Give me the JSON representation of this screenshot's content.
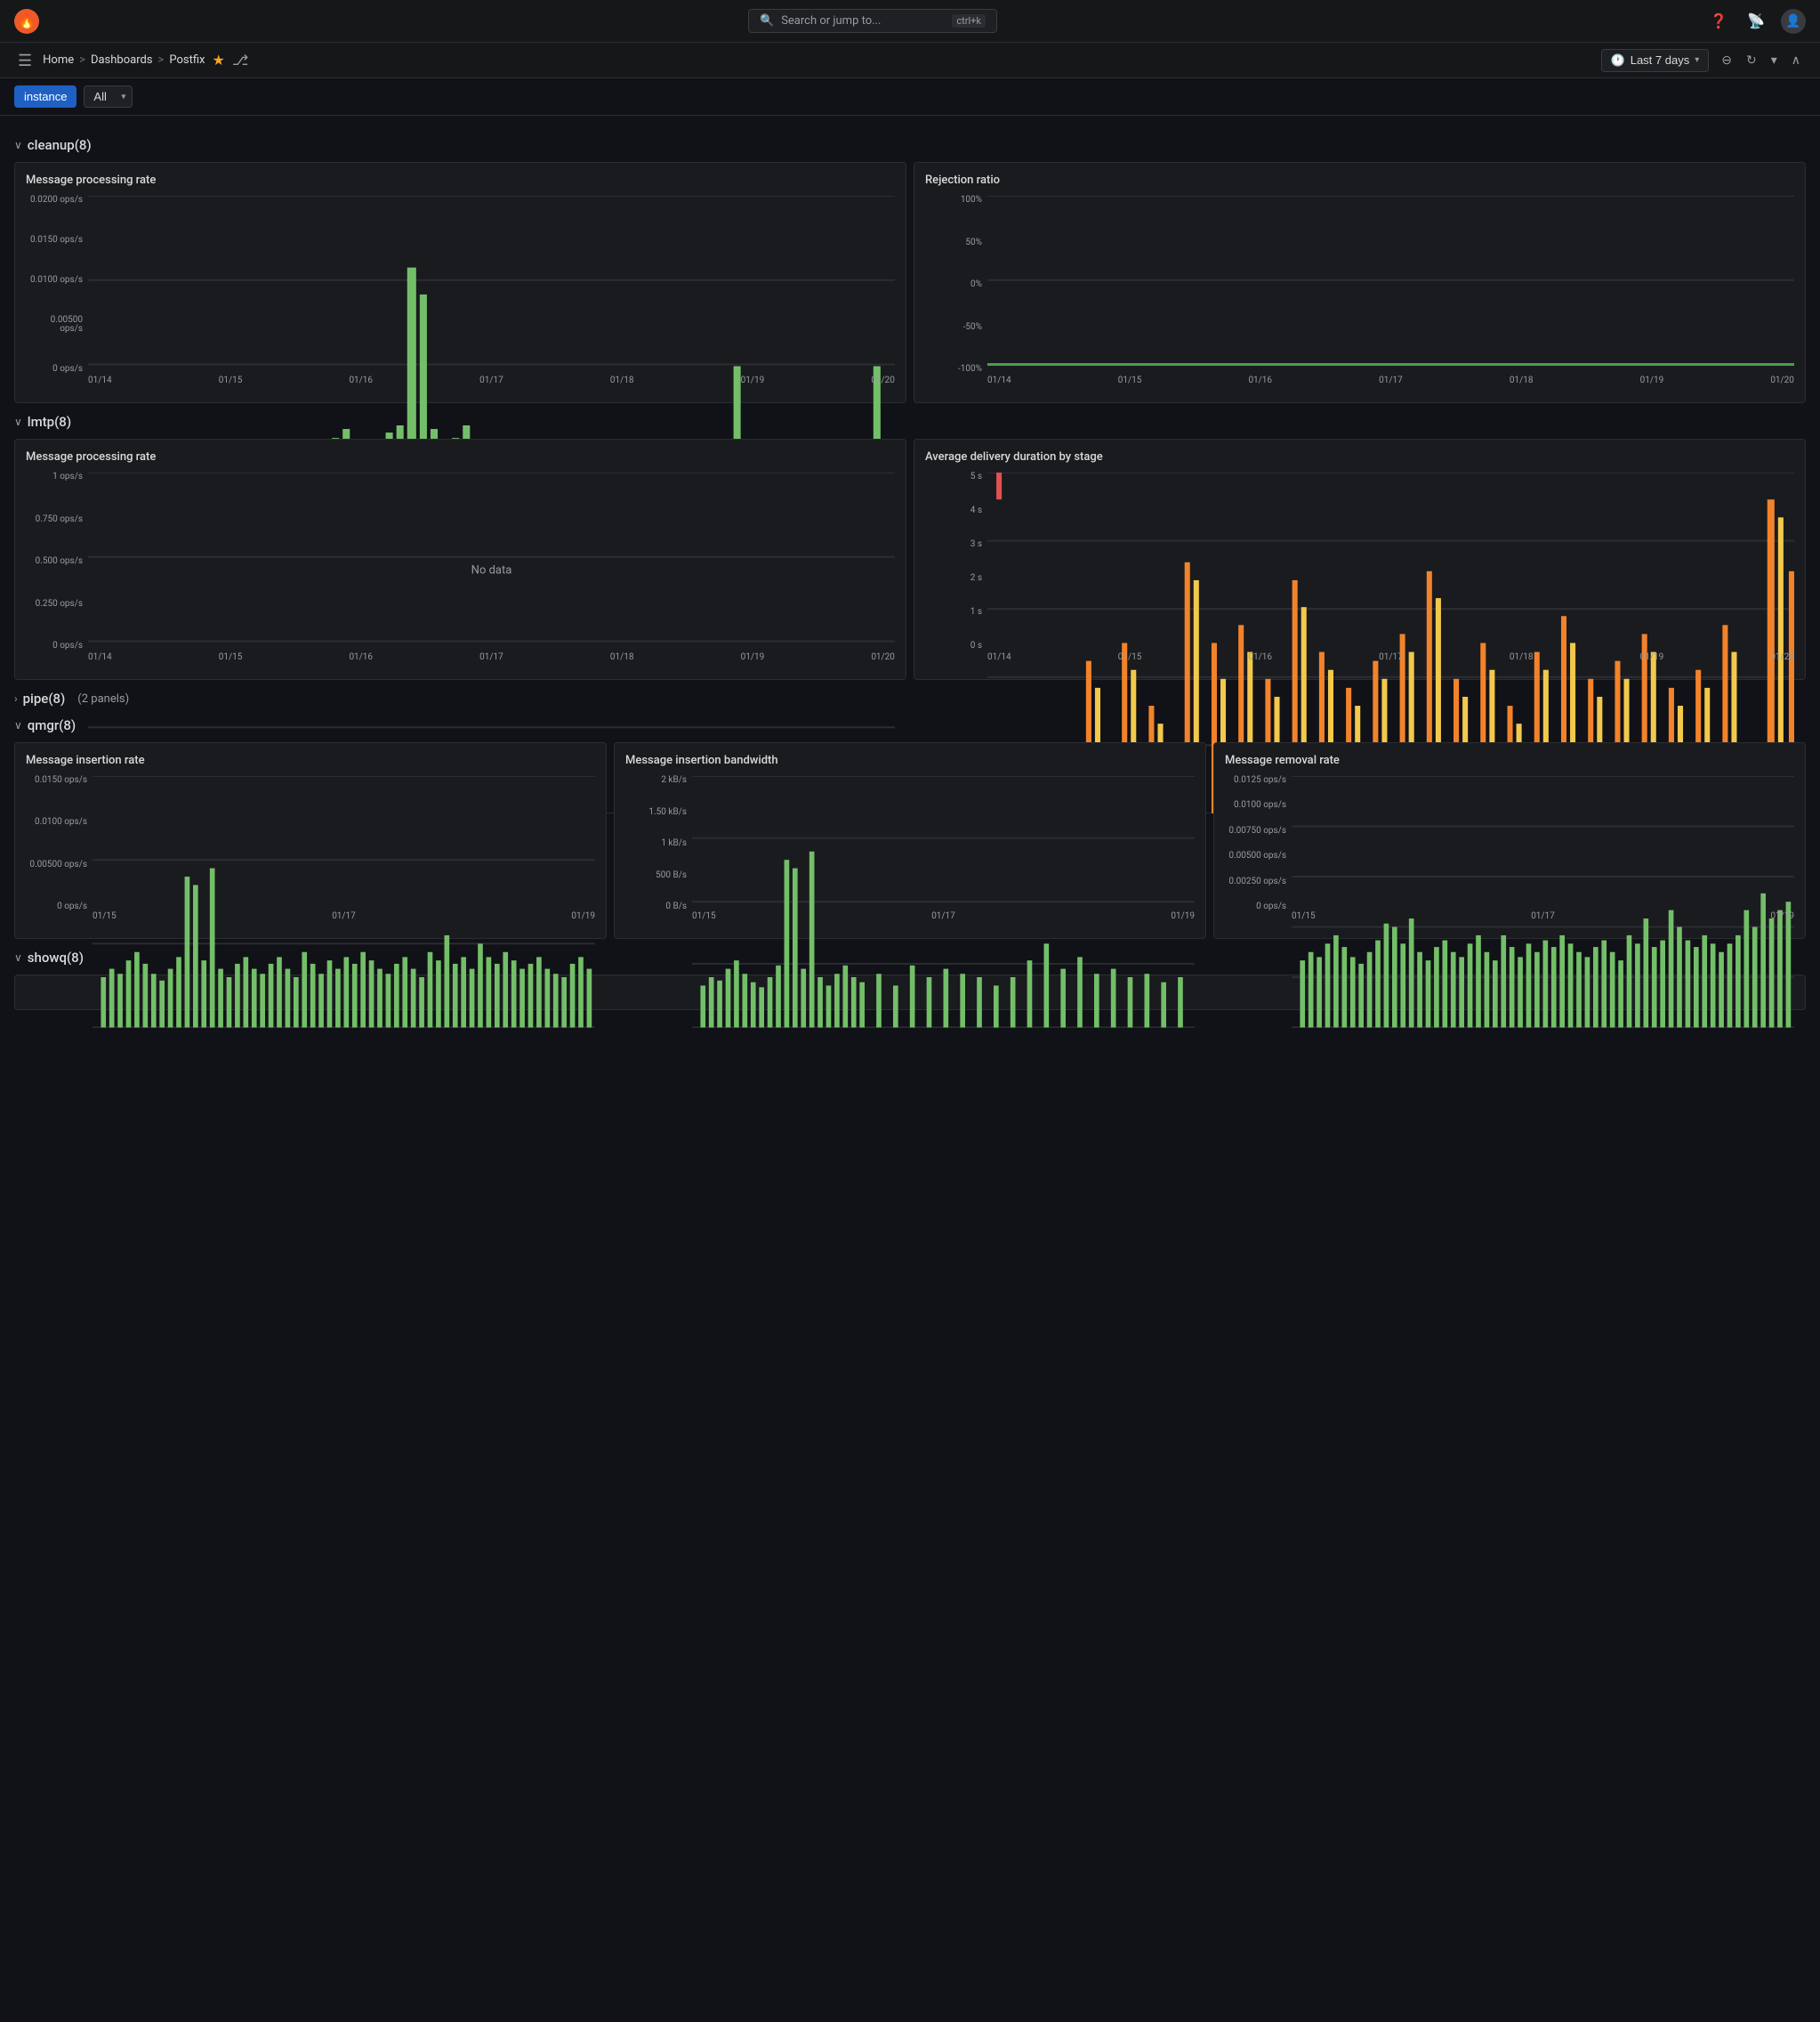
{
  "app": {
    "logo": "🔥",
    "title": "Grafana"
  },
  "topnav": {
    "search_placeholder": "Search or jump to...",
    "search_shortcut": "ctrl+k",
    "help_icon": "?",
    "news_icon": "📡",
    "profile_icon": "👤"
  },
  "breadcrumb": {
    "home": "Home",
    "sep1": ">",
    "dashboards": "Dashboards",
    "sep2": ">",
    "current": "Postfix"
  },
  "toolbar": {
    "time_range": "Last 7 days",
    "zoom_out": "⊖",
    "refresh": "↻",
    "chevron": "▾",
    "collapse": "∧"
  },
  "filters": {
    "instance_label": "instance",
    "all_label": "All"
  },
  "sections": {
    "cleanup": {
      "label": "cleanup(8)",
      "chevron": "∨",
      "panels": [
        {
          "title": "Message processing rate",
          "y_labels": [
            "0.0200 ops/s",
            "0.0150 ops/s",
            "0.0100 ops/s",
            "0.00500 ops/s",
            "0 ops/s"
          ],
          "x_labels": [
            "01/14",
            "01/15",
            "01/16",
            "01/17",
            "01/18",
            "01/19",
            "01/20"
          ]
        },
        {
          "title": "Rejection ratio",
          "y_labels": [
            "100%",
            "50%",
            "0%",
            "-50%",
            "-100%"
          ],
          "x_labels": [
            "01/14",
            "01/15",
            "01/16",
            "01/17",
            "01/18",
            "01/19",
            "01/20"
          ]
        }
      ]
    },
    "lmtp": {
      "label": "lmtp(8)",
      "chevron": "∨",
      "panels": [
        {
          "title": "Message processing rate",
          "y_labels": [
            "1 ops/s",
            "0.750 ops/s",
            "0.500 ops/s",
            "0.250 ops/s",
            "0 ops/s"
          ],
          "x_labels": [
            "01/14",
            "01/15",
            "01/16",
            "01/17",
            "01/18",
            "01/19",
            "01/20"
          ],
          "no_data": "No data"
        },
        {
          "title": "Average delivery duration by stage",
          "y_labels": [
            "5 s",
            "4 s",
            "3 s",
            "2 s",
            "1 s",
            "0 s"
          ],
          "x_labels": [
            "01/14",
            "01/15",
            "01/16",
            "01/17",
            "01/18",
            "01/19",
            "01/20"
          ]
        }
      ]
    },
    "pipe": {
      "label": "pipe(8)",
      "subtitle": "(2 panels)",
      "chevron": "›"
    },
    "qmgr": {
      "label": "qmgr(8)",
      "chevron": "∨",
      "panels": [
        {
          "title": "Message insertion rate",
          "y_labels": [
            "0.0150 ops/s",
            "0.0100 ops/s",
            "0.00500 ops/s",
            "0 ops/s"
          ],
          "x_labels": [
            "01/15",
            "01/17",
            "01/19"
          ]
        },
        {
          "title": "Message insertion bandwidth",
          "y_labels": [
            "2 kB/s",
            "1.50 kB/s",
            "1 kB/s",
            "500 B/s",
            "0 B/s"
          ],
          "x_labels": [
            "01/15",
            "01/17",
            "01/19"
          ]
        },
        {
          "title": "Message removal rate",
          "y_labels": [
            "0.0125 ops/s",
            "0.0100 ops/s",
            "0.00750 ops/s",
            "0.00500 ops/s",
            "0.00250 ops/s",
            "0 ops/s"
          ],
          "x_labels": [
            "01/15",
            "01/17",
            "01/19"
          ]
        }
      ]
    },
    "showq": {
      "label": "showq(8)",
      "chevron": "∨"
    }
  }
}
